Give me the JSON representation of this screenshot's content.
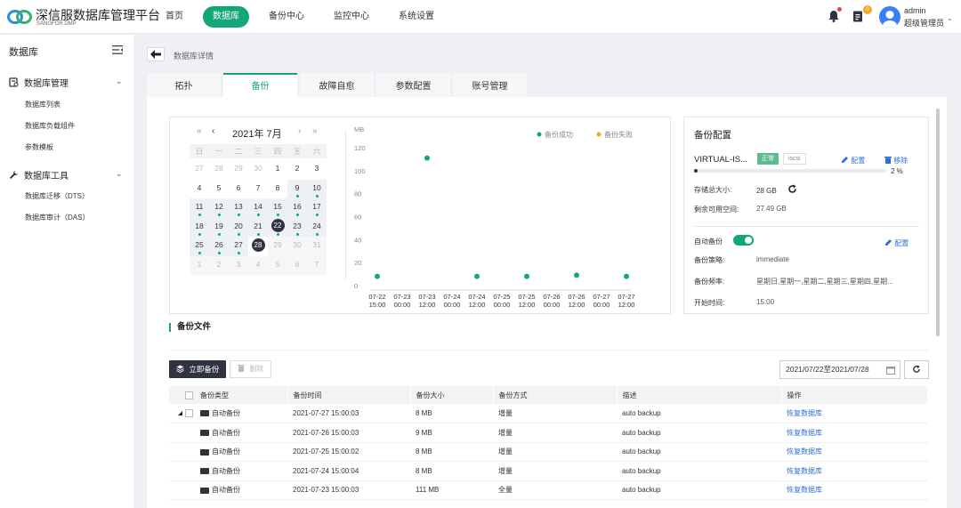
{
  "header": {
    "brand_title": "深信服数据库管理平台",
    "brand_sub": "SANGFOR DMP",
    "nav": [
      "首页",
      "数据库",
      "备份中心",
      "监控中心",
      "系统设置"
    ],
    "nav_active": "数据库",
    "notification_badge": "0",
    "user_name": "admin",
    "user_role": "超级管理员"
  },
  "sidebar": {
    "title": "数据库",
    "groups": [
      {
        "label": "数据库管理",
        "icon": "database-manage-icon",
        "items": [
          "数据库列表",
          "数据库负载组件",
          "参数模板"
        ]
      },
      {
        "label": "数据库工具",
        "icon": "wrench-icon",
        "items": [
          "数据库迁移（DTS）",
          "数据库审计（DAS）"
        ]
      }
    ]
  },
  "breadcrumb": "数据库详情",
  "tabs": [
    "拓扑",
    "备份",
    "故障自愈",
    "参数配置",
    "账号管理"
  ],
  "tab_active": "备份",
  "calendar": {
    "title": "2021年 7月",
    "weekdays": [
      "日",
      "一",
      "二",
      "三",
      "四",
      "五",
      "六"
    ],
    "weeks": [
      [
        "27",
        "28",
        "29",
        "30",
        "1",
        "2",
        "3"
      ],
      [
        "4",
        "5",
        "6",
        "7",
        "8",
        "9",
        "10"
      ],
      [
        "11",
        "12",
        "13",
        "14",
        "15",
        "16",
        "17"
      ],
      [
        "18",
        "19",
        "20",
        "21",
        "22",
        "23",
        "24"
      ],
      [
        "25",
        "26",
        "27",
        "28",
        "29",
        "30",
        "31"
      ],
      [
        "1",
        "2",
        "3",
        "4",
        "5",
        "6",
        "7"
      ]
    ],
    "backup_days": [
      "9",
      "10",
      "11",
      "12",
      "13",
      "14",
      "15",
      "16",
      "17",
      "18",
      "19",
      "20",
      "21",
      "22",
      "23",
      "24",
      "25",
      "26",
      "27"
    ],
    "circled_days": [
      "22",
      "28"
    ]
  },
  "chart_data": {
    "type": "scatter",
    "ylabel": "MB",
    "ylim": [
      0,
      120
    ],
    "yticks": [
      0,
      20,
      40,
      60,
      80,
      100,
      120
    ],
    "x_tick_labels": [
      [
        "07-22",
        "15:00"
      ],
      [
        "07-23",
        "00:00"
      ],
      [
        "07-23",
        "12:00"
      ],
      [
        "07-24",
        "00:00"
      ],
      [
        "07-24",
        "12:00"
      ],
      [
        "07-25",
        "00:00"
      ],
      [
        "07-25",
        "12:00"
      ],
      [
        "07-26",
        "00:00"
      ],
      [
        "07-26",
        "12:00"
      ],
      [
        "07-27",
        "00:00"
      ],
      [
        "07-27",
        "12:00"
      ]
    ],
    "x_range_hours": [
      0,
      120
    ],
    "legend": [
      {
        "name": "备份成功",
        "color": "#13a679"
      },
      {
        "name": "备份失败",
        "color": "#f5a623"
      }
    ],
    "series": [
      {
        "name": "备份成功",
        "color": "#13a679",
        "points": [
          {
            "x_hours": 0,
            "y": 8
          },
          {
            "x_hours": 24,
            "y": 111
          },
          {
            "x_hours": 48,
            "y": 8
          },
          {
            "x_hours": 72,
            "y": 8
          },
          {
            "x_hours": 96,
            "y": 9
          },
          {
            "x_hours": 120,
            "y": 8
          }
        ]
      },
      {
        "name": "备份失败",
        "color": "#f5a623",
        "points": []
      }
    ]
  },
  "backup_config": {
    "title": "备份配置",
    "target_name": "VIRTUAL-IS...",
    "status_tag": "正常",
    "protocol_tag": "iscsi",
    "config_link": "配置",
    "remove_link": "移除",
    "usage_percent": 2,
    "usage_text": "2 %",
    "total_label": "存储总大小:",
    "total_value": "28 GB",
    "free_label": "剩余可用空间:",
    "free_value": "27.49 GB",
    "auto_label": "自动备份",
    "auto_enabled": true,
    "config_link2": "配置",
    "policy_label": "备份策略:",
    "policy_value": "immediate",
    "freq_label": "备份频率:",
    "freq_value": "星期日,星期一,星期二,星期三,星期四,星期...",
    "start_label": "开始时间:",
    "start_value": "15:00"
  },
  "files": {
    "title": "备份文件",
    "backup_now": "立即备份",
    "delete": "删除",
    "date_range": "2021/07/22至2021/07/28",
    "columns": [
      "备份类型",
      "备份时间",
      "备份大小",
      "备份方式",
      "描述",
      "操作"
    ],
    "rows": [
      {
        "type": "自动备份",
        "time": "2021-07-27 15:00:03",
        "size": "8 MB",
        "mode": "增量",
        "desc": "auto backup",
        "op": "恢复数据库"
      },
      {
        "type": "自动备份",
        "time": "2021-07-26 15:00:03",
        "size": "9 MB",
        "mode": "增量",
        "desc": "auto backup",
        "op": "恢复数据库"
      },
      {
        "type": "自动备份",
        "time": "2021-07-25 15:00:02",
        "size": "8 MB",
        "mode": "增量",
        "desc": "auto backup",
        "op": "恢复数据库"
      },
      {
        "type": "自动备份",
        "time": "2021-07-24 15:00:04",
        "size": "8 MB",
        "mode": "增量",
        "desc": "auto backup",
        "op": "恢复数据库"
      },
      {
        "type": "自动备份",
        "time": "2021-07-23 15:00:03",
        "size": "111 MB",
        "mode": "全量",
        "desc": "auto backup",
        "op": "恢复数据库"
      }
    ]
  }
}
